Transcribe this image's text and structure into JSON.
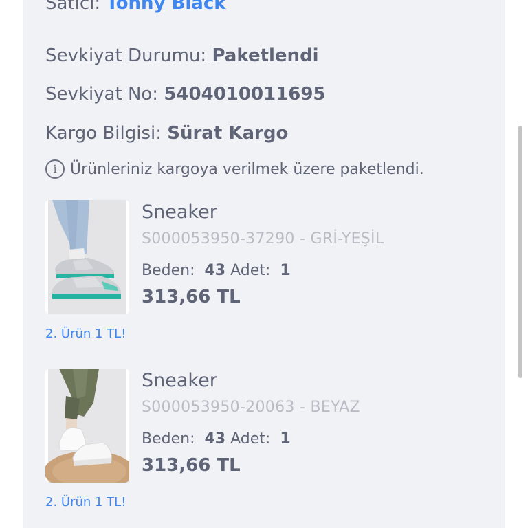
{
  "order": {
    "seller_label": "Satıcı:",
    "seller_name": "Tonny Black",
    "status_label": "Sevkiyat Durumu:",
    "status_value": "Paketlendi",
    "shipment_label": "Sevkiyat No:",
    "shipment_value": "5404010011695",
    "cargo_label": "Kargo Bilgisi:",
    "cargo_value": "Sürat Kargo",
    "info_text": "Ürünleriniz kargoya verilmek üzere paketlendi."
  },
  "products": [
    {
      "name": "Sneaker",
      "code": "S000053950-37290 - GRİ-YEŞİL",
      "size_label": "Beden:",
      "size_value": "43",
      "qty_label": "Adet:",
      "qty_value": "1",
      "price": "313,66 TL",
      "promo": "2. Ürün 1 TL!"
    },
    {
      "name": "Sneaker",
      "code": "S000053950-20063 - BEYAZ",
      "size_label": "Beden:",
      "size_value": "43",
      "qty_label": "Adet:",
      "qty_value": "1",
      "price": "313,66 TL",
      "promo": "2. Ürün 1 TL!"
    }
  ],
  "colors": {
    "accent": "#3f86f0",
    "text": "#5f6577",
    "muted": "#b9bcc5",
    "card_bg": "#f1f2f5"
  }
}
